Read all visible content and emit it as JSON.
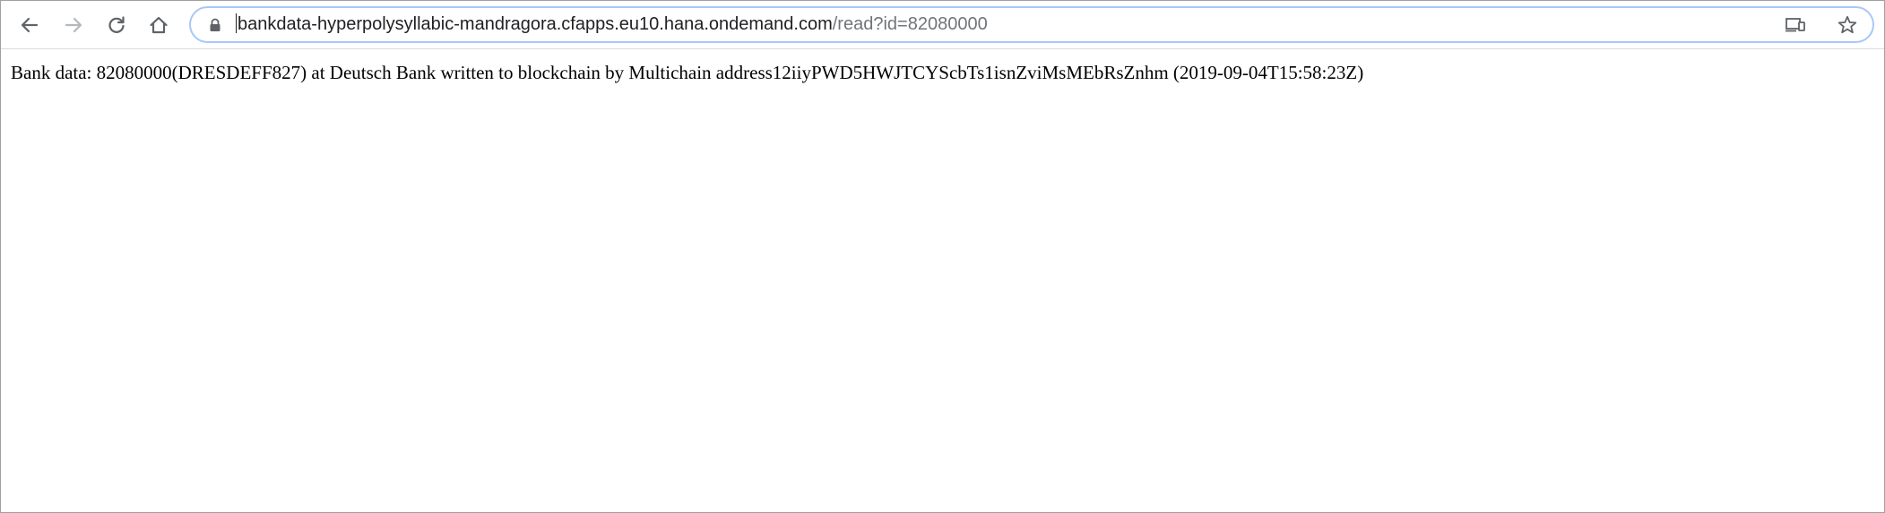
{
  "browser": {
    "url_host": "bankdata-hyperpolysyllabic-mandragora.cfapps.eu10.hana.ondemand.com",
    "url_path": "/read?id=82080000"
  },
  "page": {
    "text": "Bank data: 82080000(DRESDEFF827) at Deutsch Bank written to blockchain by Multichain address12iiyPWD5HWJTCYScbTs1isnZviMsMEbRsZnhm (2019-09-04T15:58:23Z)"
  },
  "icons": {
    "back": "arrow-left-icon",
    "forward": "arrow-right-icon",
    "reload": "reload-icon",
    "home": "home-icon",
    "lock": "lock-icon",
    "cast": "cast-icon",
    "bookmark": "star-icon"
  },
  "colors": {
    "omnibox_border": "#a8c7fa",
    "url_host": "#202124",
    "url_path": "#70757a"
  }
}
